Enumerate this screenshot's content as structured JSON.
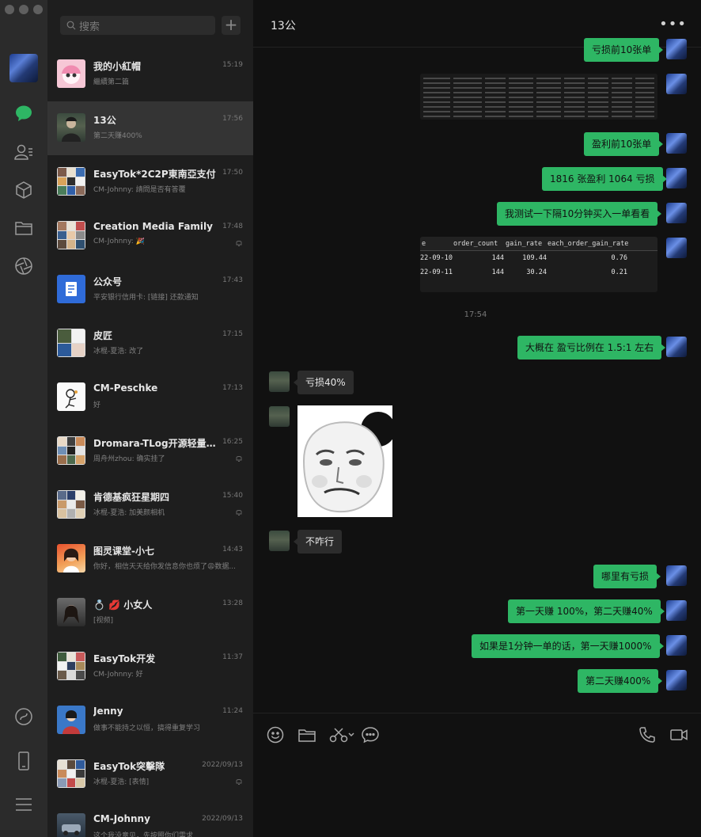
{
  "search": {
    "placeholder": "搜索"
  },
  "conversations": [
    {
      "name": "我的小紅帽",
      "time": "15:19",
      "preview": "繼續第二篇"
    },
    {
      "name": "13公",
      "time": "17:56",
      "preview": "第二天赚400%"
    },
    {
      "name": "EasyTok*2C2P東南亞支付",
      "time": "17:50",
      "preview": "CM-Johnny: 請問是否有答覆"
    },
    {
      "name": "Creation Media Family",
      "time": "17:48",
      "preview": "CM-Johnny: 🎉"
    },
    {
      "name": "公众号",
      "time": "17:43",
      "preview": "平安银行信用卡: [链接] 还款通知"
    },
    {
      "name": "皮匠",
      "time": "17:15",
      "preview": "冰棍-夏浩: 改了"
    },
    {
      "name": "CM-Peschke",
      "time": "17:13",
      "preview": "好"
    },
    {
      "name": "Dromara-TLog开源轻量级日...",
      "time": "16:25",
      "preview": "周舟州zhou: 确实挂了"
    },
    {
      "name": "肯德基疯狂星期四",
      "time": "15:40",
      "preview": "冰棍-夏浩: 加美颜相机"
    },
    {
      "name": "图灵课堂-小七",
      "time": "14:43",
      "preview": "你好，相信天天给你发信息你也烦了😩数据..."
    },
    {
      "name": "💍 💋 小女人",
      "time": "13:28",
      "preview": "[视频]"
    },
    {
      "name": "EasyTok开发",
      "time": "11:37",
      "preview": "CM-Johnny: 好"
    },
    {
      "name": "Jenny",
      "time": "11:24",
      "preview": "做事不能持之以恒，搞得重复学习"
    },
    {
      "name": "EasyTok突擊隊",
      "time": "2022/09/13",
      "preview": "冰棍-夏浩: [表情]"
    },
    {
      "name": "CM-Johnny",
      "time": "2022/09/13",
      "preview": "这个我没意见，先按照你们需求"
    }
  ],
  "chat": {
    "title": "13公",
    "more": "•••",
    "messages": {
      "m1": "亏损前10张单",
      "m2": "盈利前10张单",
      "m3": "1816 张盈利 1064 亏损",
      "m4": "我测试一下隔10分钟买入一单看看",
      "timestamp": "17:54",
      "m5": "大概在 盈亏比例在 1.5:1 左右",
      "t1": "亏损40%",
      "t2": "不咋行",
      "m6": "哪里有亏损",
      "m7": "第一天赚 100%，第二天赚40%",
      "m8": "如果是1分钟一单的话，第一天赚1000%",
      "m9": "第二天赚400%"
    },
    "table_image": {
      "headers": [
        "e",
        "order_count",
        "gain_rate",
        "each_order_gain_rate"
      ],
      "rows": [
        [
          "22-09-10",
          "144",
          "109.44",
          "0.76"
        ],
        [
          "22-09-11",
          "144",
          "30.24",
          "0.21"
        ]
      ]
    }
  },
  "icons": {
    "rail": [
      "chat-icon",
      "contacts-icon",
      "collections-icon",
      "files-icon",
      "moments-icon",
      "mini-programs-icon",
      "phone-icon",
      "menu-icon"
    ],
    "toolbar": [
      "emoji-icon",
      "folder-icon",
      "scissors-icon",
      "chat-history-icon",
      "voice-call-icon",
      "video-call-icon"
    ]
  },
  "colors": {
    "accent": "#2eb664",
    "rail_bg": "#2b2b2b",
    "list_bg": "#1e1e1e",
    "chat_bg": "#111111"
  }
}
